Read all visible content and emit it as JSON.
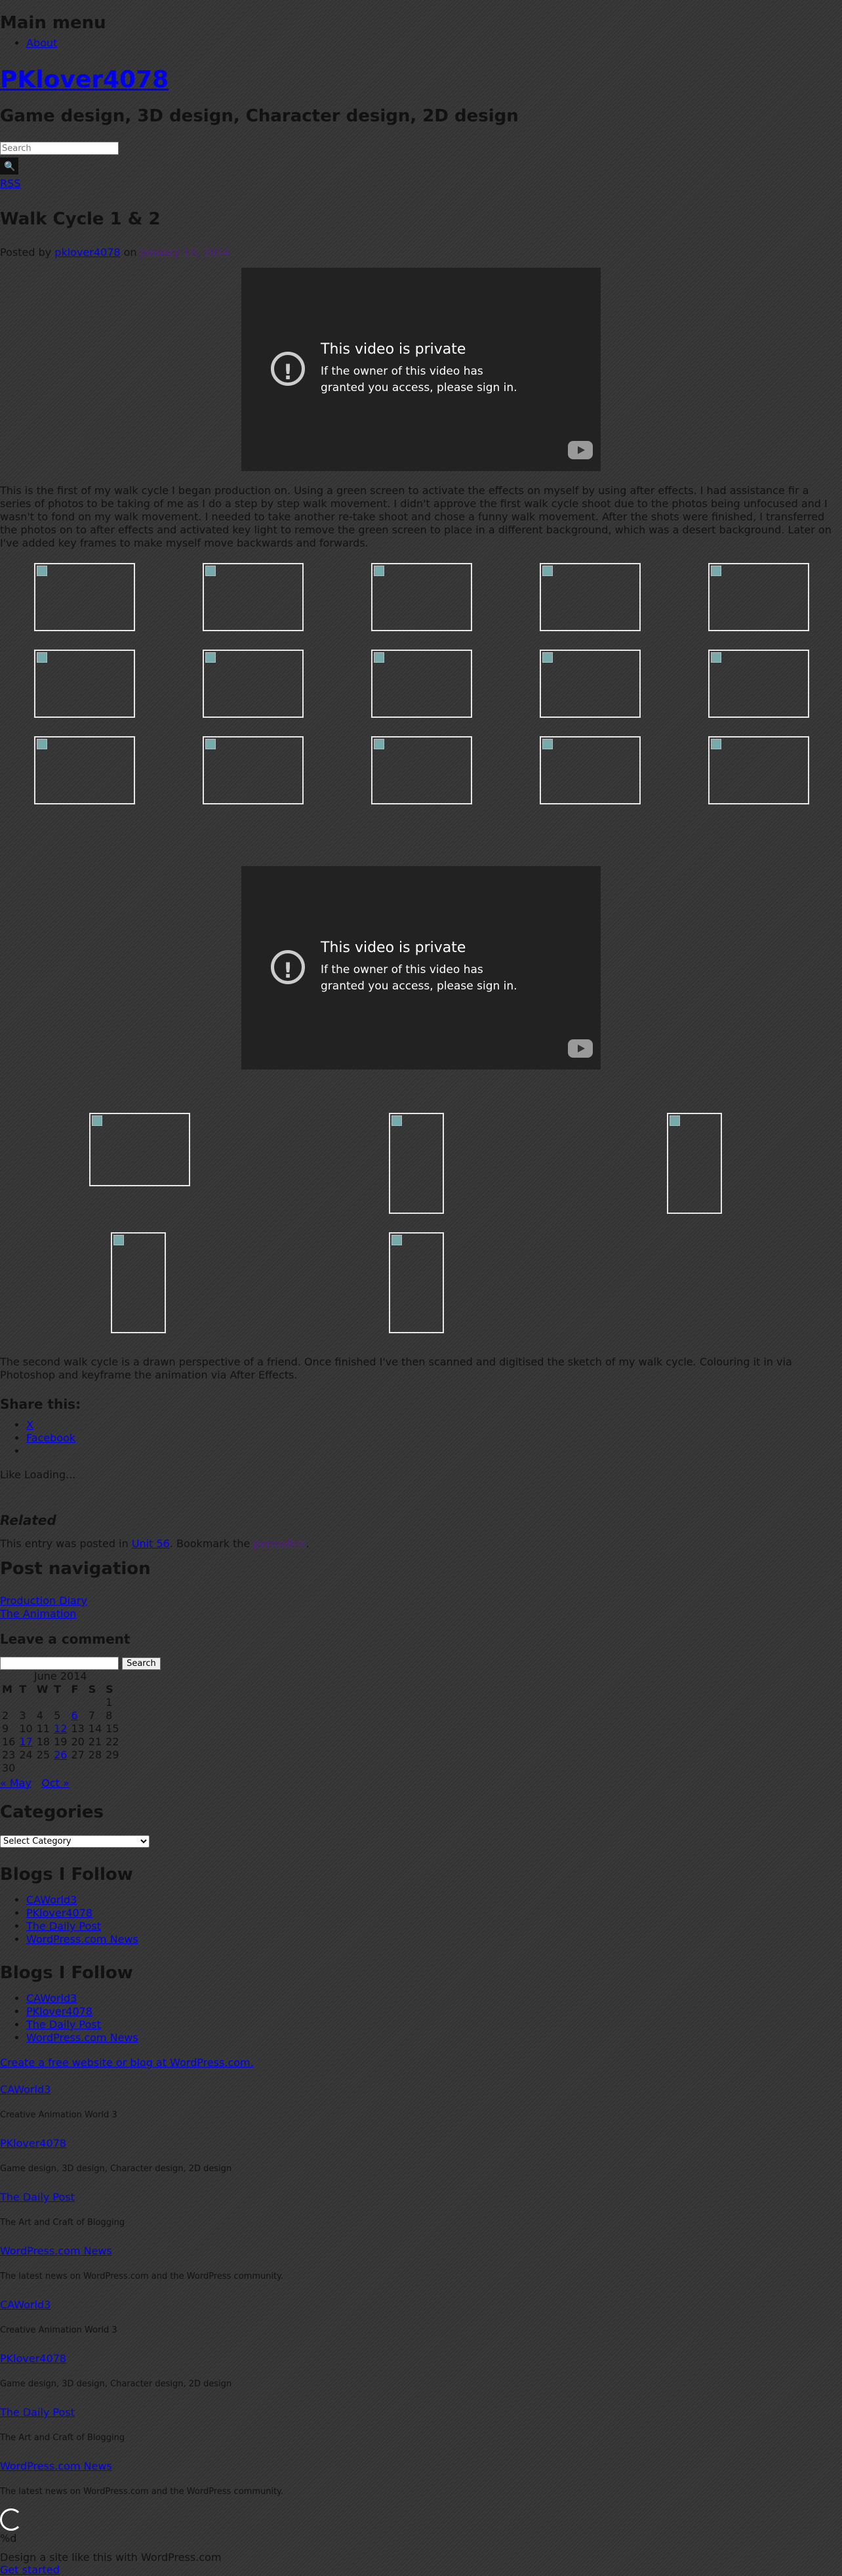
{
  "menu": {
    "title": "Main menu",
    "items": [
      "About"
    ]
  },
  "site": {
    "title": "PKlover4078",
    "description": "Game design, 3D design, Character design, 2D design"
  },
  "search": {
    "placeholder": "Search"
  },
  "rss": "RSS",
  "post": {
    "title": "Walk Cycle 1 & 2",
    "posted_by": "Posted by",
    "author": "pklover4078",
    "on": "on",
    "date": "January 13, 2014",
    "video": {
      "title": "This video is private",
      "message": "If the owner of this video has granted you access, please sign in."
    },
    "para1": "This is the first of my walk cycle I began production on. Using a green screen to activate the effects on myself by using after effects. I had assistance fir a series of photos to be taking of me as I do a step by step walk movement. I didn't approve the first walk cycle shoot due to the photos being unfocused and I wasn't to fond on my walk movement. I needed to take another re-take shoot and chose a funny walk movement. After the shots were finished, I transferred the photos on to after effects and activated key light to remove the green screen to place in a different background, which was a desert background. Later on I've added key frames to make myself move backwards and forwards.",
    "para2": "The second walk cycle is a drawn perspective of a friend. Once finished I've then scanned and digitised the sketch of my walk cycle. Colouring it in via Photoshop and keyframe the animation via After Effects."
  },
  "share": {
    "title": "Share this:",
    "items": [
      "X",
      "Facebook",
      ""
    ]
  },
  "like": "Like Loading...",
  "related": "Related",
  "entry_meta": {
    "prefix": "This entry was posted in",
    "category": "Unit 56",
    "middle": ". Bookmark the",
    "permalink": "permalink",
    "suffix": "."
  },
  "post_nav": {
    "title": "Post navigation",
    "prev": "Production Diary",
    "next": "The Animation"
  },
  "comment": {
    "title": "Leave a comment",
    "button": "Search"
  },
  "calendar": {
    "caption": "June 2014",
    "headers": [
      "M",
      "T",
      "W",
      "T",
      "F",
      "S",
      "S"
    ],
    "rows": [
      [
        "",
        "",
        "",
        "",
        "",
        "",
        "1"
      ],
      [
        "2",
        "3",
        "4",
        "5",
        "6",
        "7",
        "8"
      ],
      [
        "9",
        "10",
        "11",
        "12",
        "13",
        "14",
        "15"
      ],
      [
        "16",
        "17",
        "18",
        "19",
        "20",
        "21",
        "22"
      ],
      [
        "23",
        "24",
        "25",
        "26",
        "27",
        "28",
        "29"
      ],
      [
        "30",
        "",
        "",
        "",
        "",
        "",
        ""
      ]
    ],
    "prev": "« May",
    "next": "Oct »"
  },
  "categories": {
    "title": "Categories",
    "select": "Select Category"
  },
  "blogs1": {
    "title": "Blogs I Follow",
    "items": [
      "CAWorld3",
      "PKlover4078",
      "The Daily Post",
      "WordPress.com News"
    ]
  },
  "blogs2": {
    "title": "Blogs I Follow",
    "items": [
      "CAWorld3",
      "PKlover4078",
      "The Daily Post",
      "WordPress.com News"
    ]
  },
  "create_link": "Create a free website or blog at WordPress.com.",
  "follow_list": [
    {
      "name": "CAWorld3",
      "desc": "Creative Animation World 3"
    },
    {
      "name": "PKlover4078",
      "desc": "Game design, 3D design, Character design, 2D design"
    },
    {
      "name": "The Daily Post",
      "desc": "The Art and Craft of Blogging"
    },
    {
      "name": "WordPress.com News",
      "desc": "The latest news on WordPress.com and the WordPress community."
    },
    {
      "name": "CAWorld3",
      "desc": "Creative Animation World 3"
    },
    {
      "name": "PKlover4078",
      "desc": "Game design, 3D design, Character design, 2D design"
    },
    {
      "name": "The Daily Post",
      "desc": "The Art and Craft of Blogging"
    },
    {
      "name": "WordPress.com News",
      "desc": "The latest news on WordPress.com and the WordPress community."
    }
  ],
  "footer": {
    "mail": "%d",
    "design": "Design a site like this with WordPress.com",
    "start": "Get started"
  }
}
